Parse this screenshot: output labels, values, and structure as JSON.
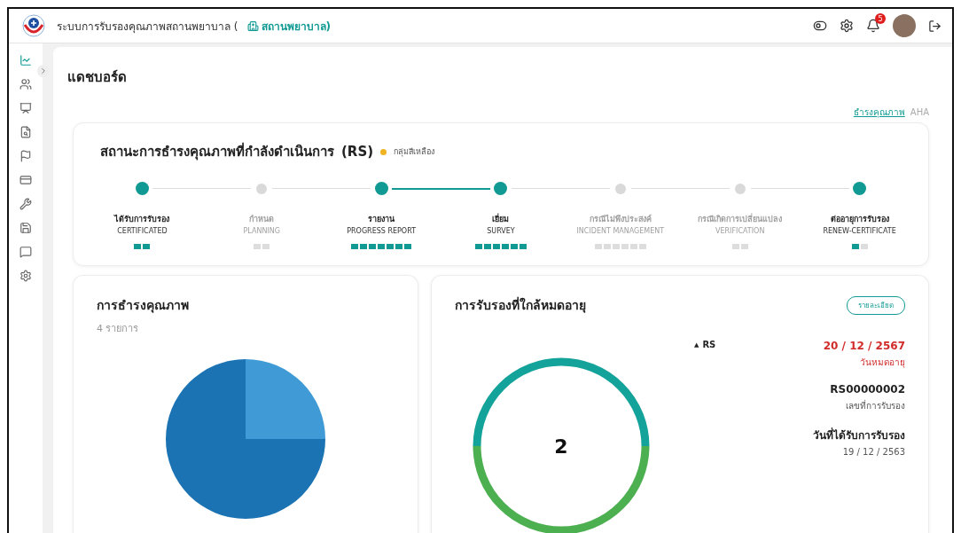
{
  "header": {
    "title": "ระบบการรับรองคุณภาพสถานพยาบาล (",
    "org": "สถานพยาบาล)",
    "notification_count": "5"
  },
  "sidebar": {
    "items": [
      {
        "kind": "chart",
        "selected": true
      },
      {
        "kind": "users",
        "selected": false
      },
      {
        "kind": "board",
        "selected": false
      },
      {
        "kind": "doc",
        "selected": false
      },
      {
        "kind": "flag",
        "selected": false
      },
      {
        "kind": "card",
        "selected": false
      },
      {
        "kind": "tool",
        "selected": false
      },
      {
        "kind": "save",
        "selected": false
      },
      {
        "kind": "chat",
        "selected": false
      },
      {
        "kind": "gear",
        "selected": false
      }
    ]
  },
  "page_title": "แดชบอร์ด",
  "tabs": [
    {
      "label": "ธำรงคุณภาพ",
      "selected": true
    },
    {
      "label": "AHA",
      "selected": false
    }
  ],
  "status": {
    "title": "สถานะการธำรงคุณภาพที่กำลังดำเนินการ",
    "code": "(RS)",
    "group": {
      "label": "กลุ่มสีเหลือง",
      "color": "#f0b323"
    },
    "steps": [
      {
        "th": "ได้รับการรับรอง",
        "en": "CERTIFICATED",
        "active": true,
        "line_active": false,
        "blocks": [
          true,
          true
        ]
      },
      {
        "th": "กำหนด",
        "en": "PLANNING",
        "active": false,
        "line_active": false,
        "blocks": [
          false,
          false
        ]
      },
      {
        "th": "รายงาน",
        "en": "PROGRESS REPORT",
        "active": true,
        "line_active": true,
        "blocks": [
          true,
          true,
          true,
          true,
          true,
          true,
          true
        ]
      },
      {
        "th": "เยี่ยม",
        "en": "SURVEY",
        "active": true,
        "line_active": false,
        "blocks": [
          true,
          true,
          true,
          true,
          true,
          true
        ]
      },
      {
        "th": "กรณีไม่พึงประสงค์",
        "en": "INCIDENT MANAGEMENT",
        "active": false,
        "line_active": false,
        "blocks": [
          false,
          false,
          false,
          false,
          false,
          false
        ]
      },
      {
        "th": "กรณีเกิดการเปลี่ยนแปลง",
        "en": "VERIFICATION",
        "active": false,
        "line_active": false,
        "blocks": [
          false,
          false
        ]
      },
      {
        "th": "ต่ออายุการรับรอง",
        "en": "RENEW-CERTIFICATE",
        "active": true,
        "blocks": [
          true,
          false
        ]
      }
    ]
  },
  "quality": {
    "title": "การธำรงคุณภาพ",
    "subtitle": "4 รายการ"
  },
  "expiring": {
    "title": "การรับรองที่ใกล้หมดอายุ",
    "button": "รายละเอียด",
    "total": "2",
    "items": [
      {
        "marker": "▲",
        "code": "RS",
        "expire_date": "20 / 12 / 2567",
        "expire_label": "วันหมดอายุ",
        "cert_no": "RS00000002",
        "cert_no_label": "เลขที่การรับรอง",
        "cert_date_label": "วันที่ได้รับการรับรอง",
        "cert_date": "19 / 12 / 2563"
      }
    ]
  }
}
